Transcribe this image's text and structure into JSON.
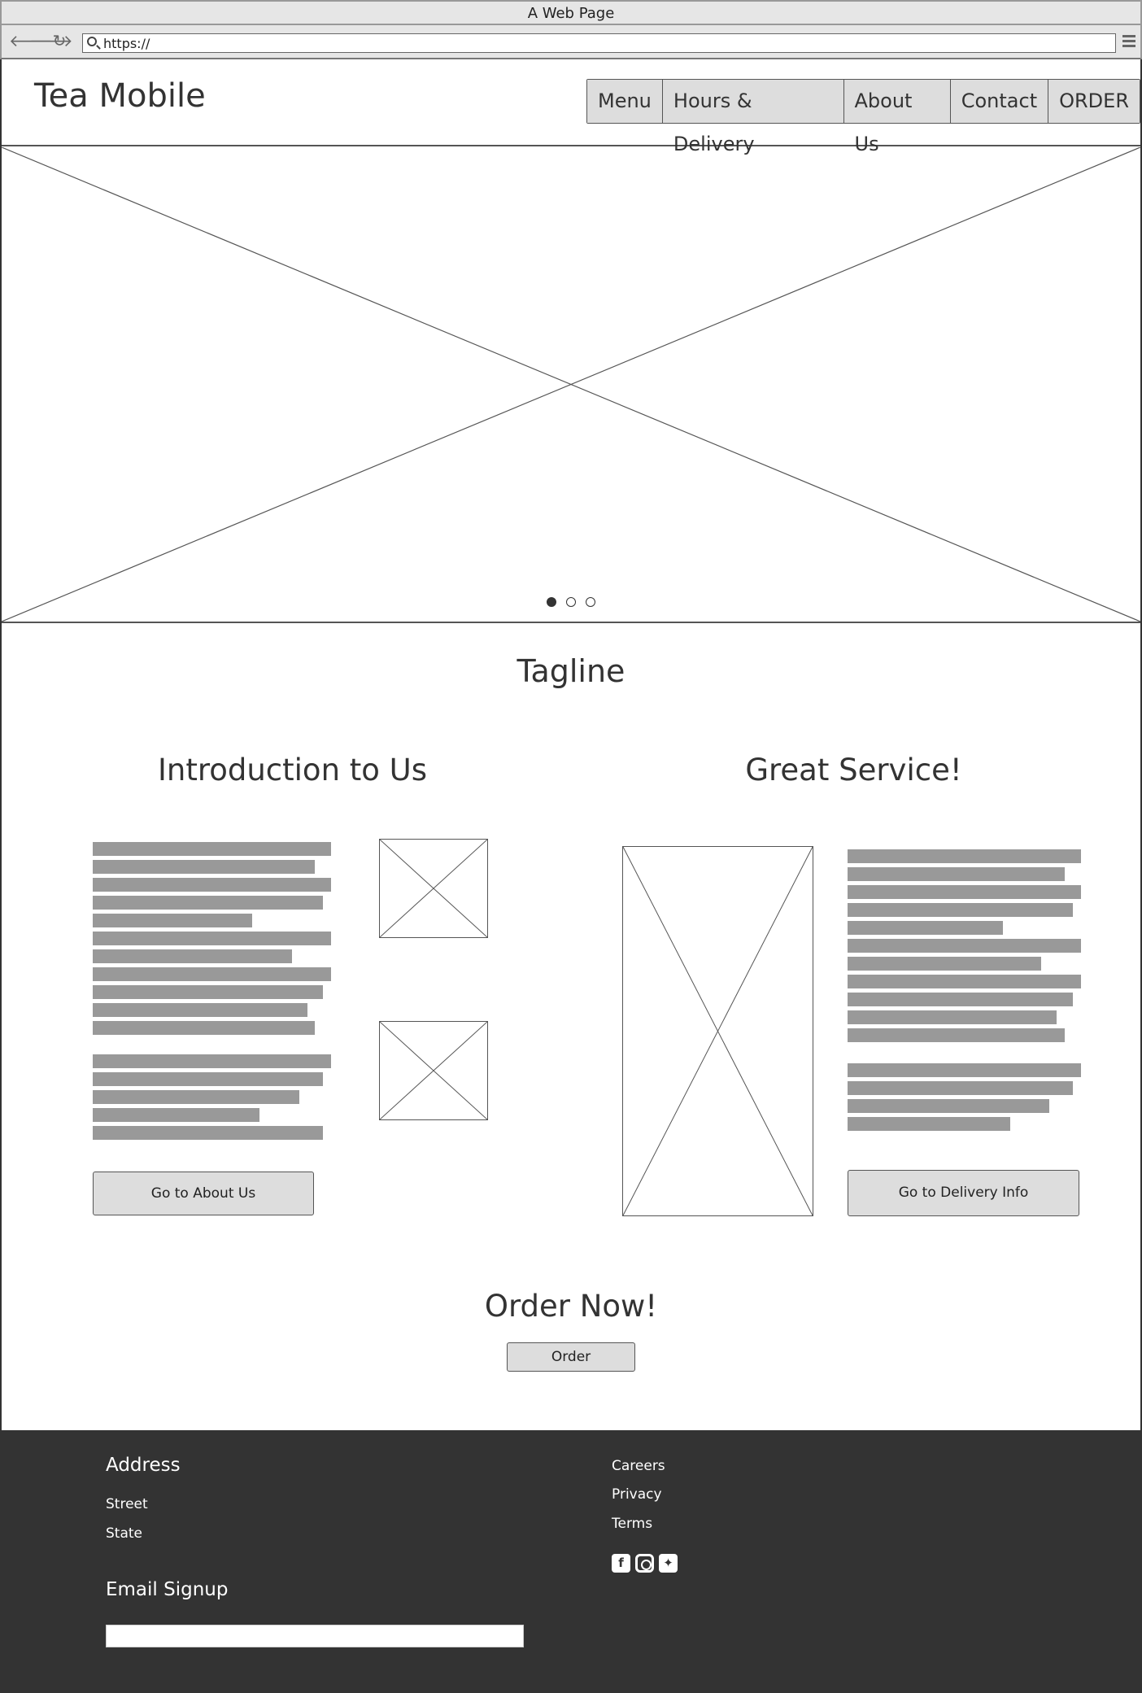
{
  "browser": {
    "window_title": "A Web Page",
    "url": "https://"
  },
  "header": {
    "brand": "Tea Mobile",
    "nav": [
      "Menu",
      "Hours & Delivery",
      "About Us",
      "Contact",
      "ORDER"
    ]
  },
  "hero": {
    "carousel_count": 3,
    "carousel_active_index": 0
  },
  "tagline": "Tagline",
  "intro": {
    "title": "Introduction to Us",
    "button_label": "Go to About Us"
  },
  "service": {
    "title": "Great Service!",
    "button_label": "Go to Delivery Info"
  },
  "order": {
    "title": "Order Now!",
    "button_label": "Order"
  },
  "footer": {
    "address_heading": "Address",
    "street": "Street",
    "state": "State",
    "email_heading": "Email Signup",
    "links": [
      "Careers",
      "Privacy",
      "Terms"
    ],
    "social": [
      "facebook-icon",
      "instagram-icon",
      "twitter-icon"
    ]
  },
  "colors": {
    "footer_bg": "#333333",
    "button_bg": "#dddddd",
    "placeholder_text_bar": "#999999"
  }
}
